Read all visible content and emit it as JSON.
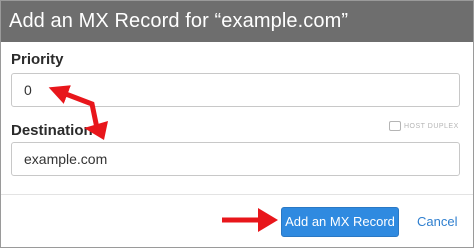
{
  "dialog": {
    "title": "Add an MX Record for “example.com”"
  },
  "form": {
    "priority": {
      "label": "Priority",
      "value": "0"
    },
    "destination": {
      "label": "Destination",
      "value": "example.com"
    }
  },
  "watermark": {
    "text": "HOST DUPLEX"
  },
  "actions": {
    "submit_label": "Add an MX Record",
    "cancel_label": "Cancel"
  },
  "colors": {
    "header_bg": "#6e6e6e",
    "primary_button": "#2f8ae0",
    "link": "#2f7fcf",
    "annotation_arrow": "#e8161b"
  }
}
